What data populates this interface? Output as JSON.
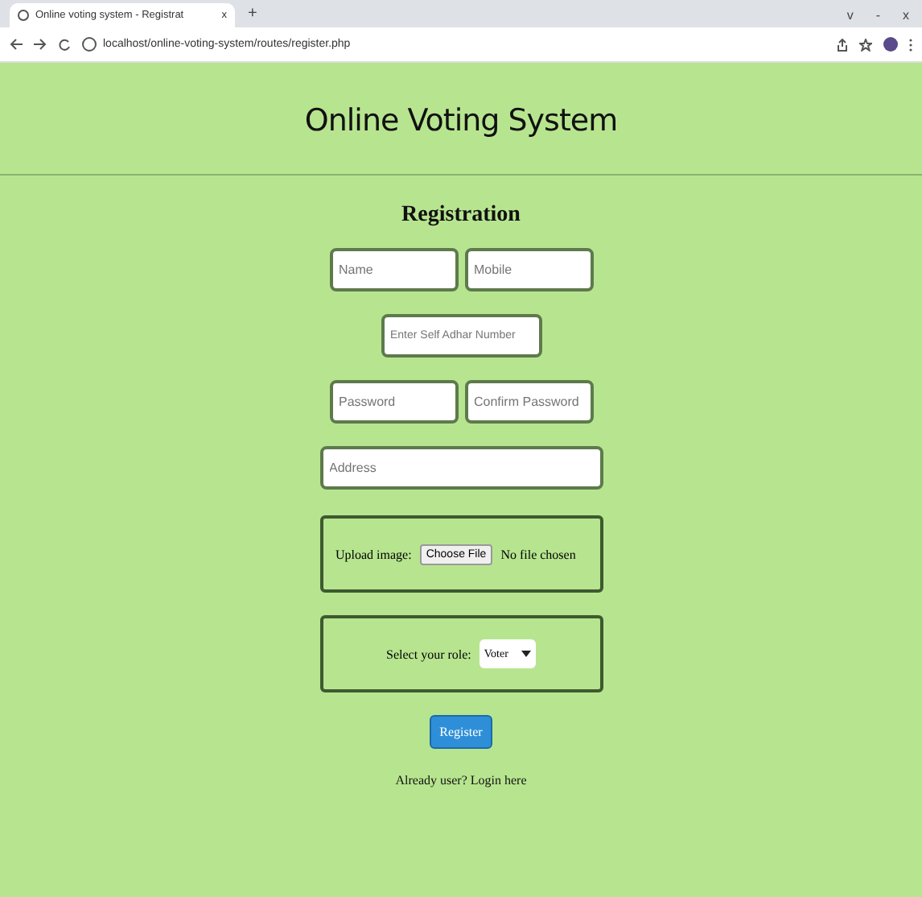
{
  "browser": {
    "tab_title": "Online voting system - Registrat",
    "url": "localhost/online-voting-system/routes/register.php",
    "tab_close": "x",
    "new_tab": "+",
    "window_controls": [
      "v",
      "-",
      "x"
    ]
  },
  "header": {
    "title": "Online Voting System"
  },
  "form": {
    "heading": "Registration",
    "rows": [
      [
        {
          "placeholder": "Name"
        },
        {
          "placeholder": "Mobile"
        }
      ],
      [
        {
          "placeholder": "Enter Self Adhar Number"
        }
      ],
      [
        {
          "placeholder": "Password"
        },
        {
          "placeholder": "Confirm Password"
        }
      ],
      [
        {
          "placeholder": "Address",
          "wide": true
        }
      ]
    ],
    "upload": {
      "label": "Upload image:",
      "button": "Choose File",
      "status": "No file chosen"
    },
    "role": {
      "label": "Select your role:",
      "value": "Voter"
    },
    "submit": "Register",
    "login": {
      "text": "Already user?",
      "link": "Login here"
    }
  }
}
